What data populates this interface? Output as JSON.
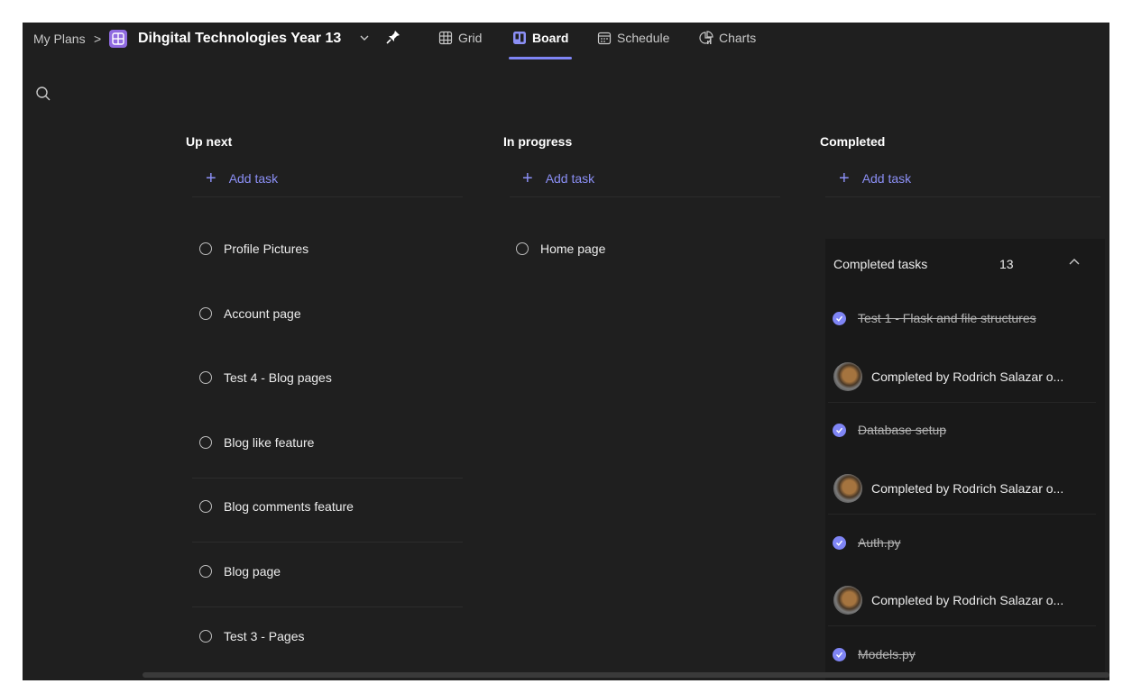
{
  "breadcrumb": {
    "root": "My Plans",
    "separator": ">"
  },
  "plan": {
    "name": "Dihgital Technologies Year 13"
  },
  "tabs": [
    {
      "label": "Grid",
      "icon": "grid-icon",
      "active": false
    },
    {
      "label": "Board",
      "icon": "board-icon",
      "active": true
    },
    {
      "label": "Schedule",
      "icon": "calendar-icon",
      "active": false
    },
    {
      "label": "Charts",
      "icon": "chart-icon",
      "active": false
    }
  ],
  "columns": [
    {
      "title": "Up next",
      "add_label": "Add task",
      "tasks": [
        "Profile Pictures",
        "Account page",
        "Test 4 - Blog pages",
        "Blog like feature",
        "Blog comments feature",
        "Blog page",
        "Test 3 - Pages"
      ]
    },
    {
      "title": "In progress",
      "add_label": "Add task",
      "tasks": [
        "Home page"
      ]
    },
    {
      "title": "Completed",
      "add_label": "Add task",
      "completed_header": "Completed tasks",
      "completed_count": "13",
      "completed_items": [
        {
          "title": "Test 1 - Flask and file structures",
          "by": "Completed by Rodrich Salazar o..."
        },
        {
          "title": "Database setup",
          "by": "Completed by Rodrich Salazar o..."
        },
        {
          "title": "Auth.py",
          "by": "Completed by Rodrich Salazar o..."
        },
        {
          "title": "Models.py"
        }
      ]
    }
  ],
  "colors": {
    "accent": "#7f85f5",
    "background": "#1f1f1f",
    "plan_icon": "#8f6ae0"
  }
}
